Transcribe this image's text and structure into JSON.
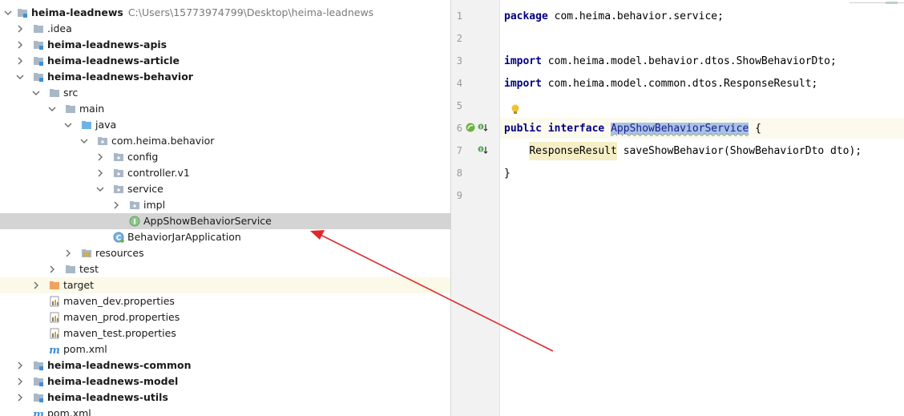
{
  "project_tree": {
    "root_label": "heima-leadnews",
    "root_path": "C:\\Users\\15773974799\\Desktop\\heima-leadnews",
    "items": [
      {
        "label": ".idea"
      },
      {
        "label": "heima-leadnews-apis"
      },
      {
        "label": "heima-leadnews-article"
      },
      {
        "label": "heima-leadnews-behavior"
      },
      {
        "label": "src"
      },
      {
        "label": "main"
      },
      {
        "label": "java"
      },
      {
        "label": "com.heima.behavior"
      },
      {
        "label": "config"
      },
      {
        "label": "controller.v1"
      },
      {
        "label": "service"
      },
      {
        "label": "impl"
      },
      {
        "label": "AppShowBehaviorService"
      },
      {
        "label": "BehaviorJarApplication"
      },
      {
        "label": "resources"
      },
      {
        "label": "test"
      },
      {
        "label": "target"
      },
      {
        "label": "maven_dev.properties"
      },
      {
        "label": "maven_prod.properties"
      },
      {
        "label": "maven_test.properties"
      },
      {
        "label": "pom.xml"
      },
      {
        "label": "heima-leadnews-common"
      },
      {
        "label": "heima-leadnews-model"
      },
      {
        "label": "heima-leadnews-utils"
      },
      {
        "label": "pom.xml"
      }
    ]
  },
  "editor": {
    "line_numbers": [
      "1",
      "2",
      "3",
      "4",
      "5",
      "6",
      "7",
      "8",
      "9"
    ],
    "line1": {
      "kw": "package",
      "rest": " com.heima.behavior.service;"
    },
    "line3": {
      "kw": "import",
      "rest": " com.heima.model.behavior.dtos.ShowBehaviorDto;"
    },
    "line4": {
      "kw": "import",
      "rest": " com.heima.model.common.dtos.ResponseResult;"
    },
    "line6": {
      "kw1": "public",
      "kw2": "interface",
      "name": "AppShowBehaviorService",
      "brace": " {"
    },
    "line7": {
      "type": "ResponseResult",
      "rest": " saveShowBehavior(ShowBehaviorDto dto);"
    },
    "line8": {
      "text": "}"
    }
  },
  "colors": {
    "selection": "#d4d4d4",
    "arrow": "#e0282a",
    "keyword": "#000080",
    "interface_badge": "#5aa65a",
    "folder": "#a9b8c8",
    "module_badge": "#3d8fd6",
    "target_folder": "#f0a35e"
  }
}
